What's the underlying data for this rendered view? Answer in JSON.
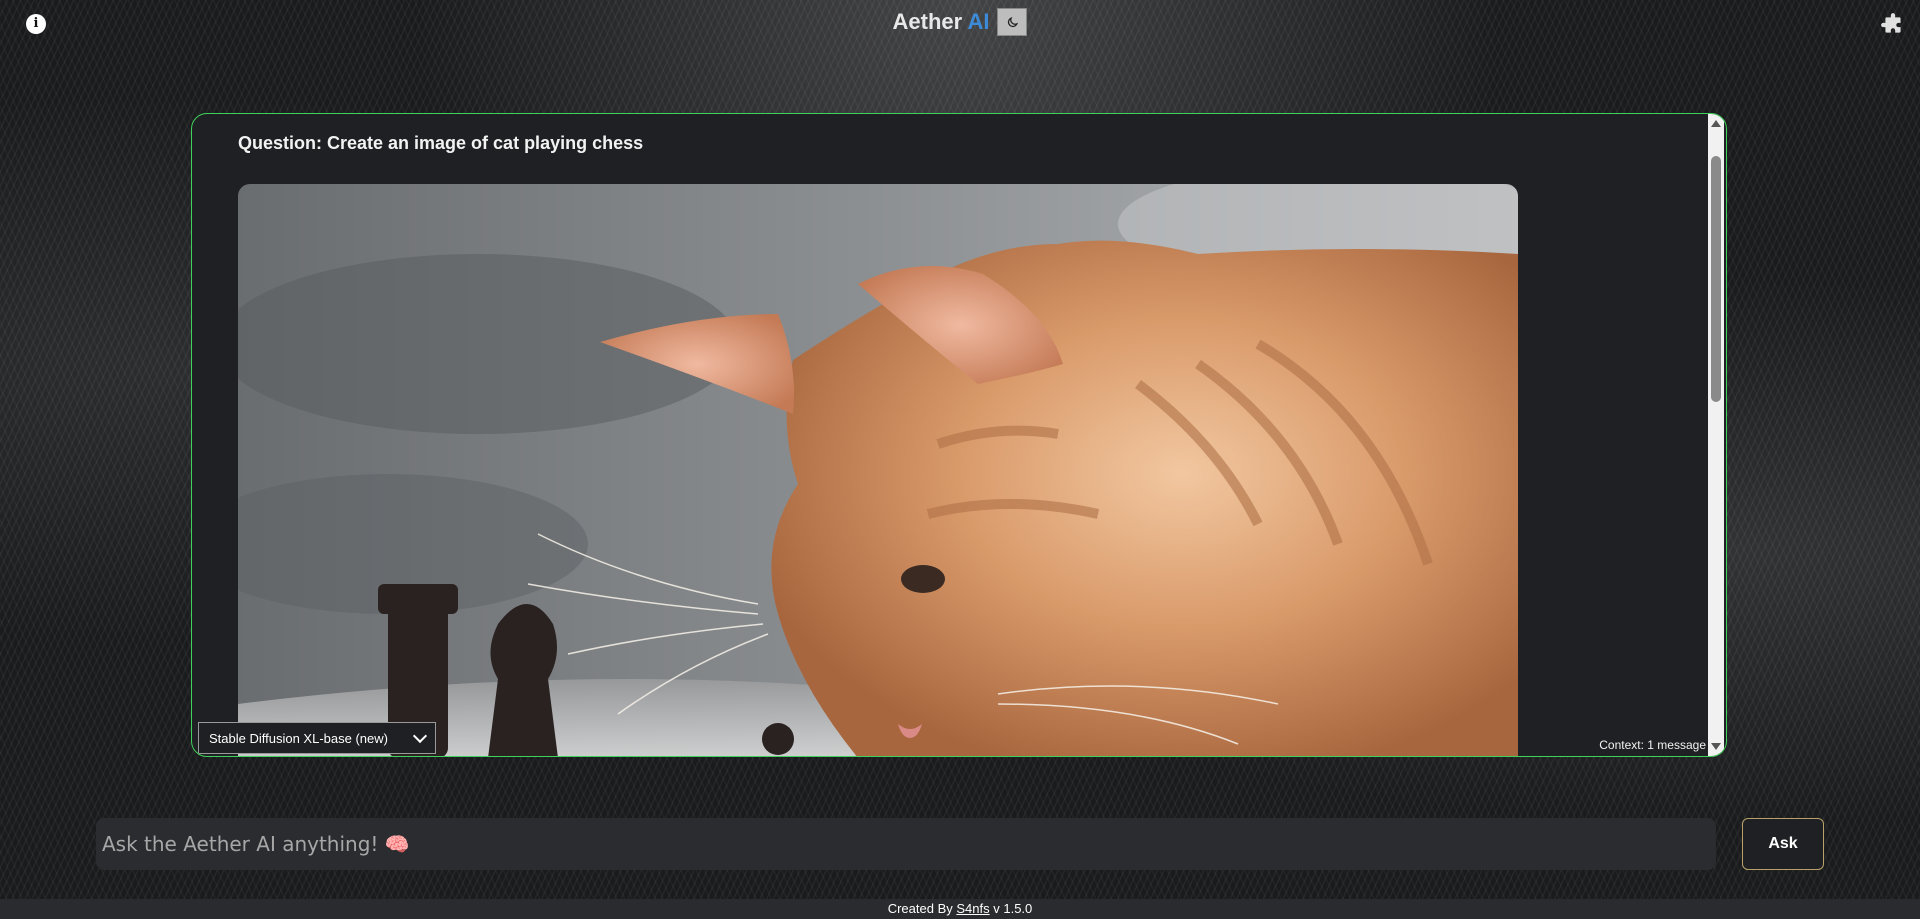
{
  "header": {
    "info_icon": "info-icon",
    "brand_name": "Aether",
    "brand_accent": "AI",
    "theme_icon": "moon-icon",
    "extension_icon": "puzzle-piece-icon"
  },
  "chat": {
    "question": "Question: Create an image of cat playing chess",
    "image_subject": "cat-playing-chess",
    "model_selected": "Stable Diffusion XL-base (new)",
    "context_label": "Context: 1 message"
  },
  "input": {
    "placeholder": "Ask the Aether AI anything! 🧠",
    "value": "",
    "ask_label": "Ask"
  },
  "footer": {
    "created_by": "Created By",
    "author": "S4nfs",
    "version": "v 1.5.0"
  },
  "colors": {
    "panel_border": "#3fd15b",
    "brand_accent": "#3d8bd8",
    "panel_bg": "#1f2023"
  }
}
